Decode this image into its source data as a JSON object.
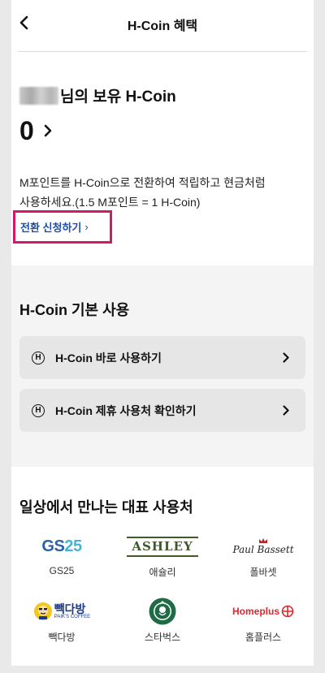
{
  "header": {
    "title": "H-Coin 혜택"
  },
  "balance": {
    "owner_suffix": "님의 보유 H-Coin",
    "coin_value": "0"
  },
  "conversion": {
    "line1": "M포인트를 H-Coin으로 전환하여 적립하고 현금처럼",
    "line2": "사용하세요.(1.5 M포인트 = 1 H-Coin)",
    "apply_label": "전환 신청하기",
    "apply_arrow": "›"
  },
  "basic_use": {
    "title": "H-Coin 기본 사용",
    "icon_letter": "H",
    "items": [
      {
        "label": "H-Coin 바로 사용하기"
      },
      {
        "label": "H-Coin 제휴 사용처 확인하기"
      }
    ]
  },
  "partners": {
    "title": "일상에서 만나는 대표 사용처",
    "items": [
      {
        "name": "GS25",
        "logo_text": "GS25"
      },
      {
        "name": "애슐리",
        "logo_text": "ASHLEY"
      },
      {
        "name": "폴바셋",
        "logo_text": "Paul Bassett"
      },
      {
        "name": "빽다방",
        "logo_text": "빽다방",
        "logo_sub": "PAIK'S COFFEE"
      },
      {
        "name": "스타벅스"
      },
      {
        "name": "홈플러스",
        "logo_text": "Homeplus"
      }
    ]
  },
  "colors": {
    "accent_link": "#1f4ea3",
    "highlight_border": "#d21a68",
    "gs25_blue": "#2d62a8",
    "gs25_cyan": "#45b3d9",
    "ashley_green": "#3f5a2a",
    "paik_yellow": "#f2c81d",
    "paik_navy": "#1d3a87",
    "starbucks_green": "#1f6b46",
    "homeplus_red": "#e0262b"
  }
}
